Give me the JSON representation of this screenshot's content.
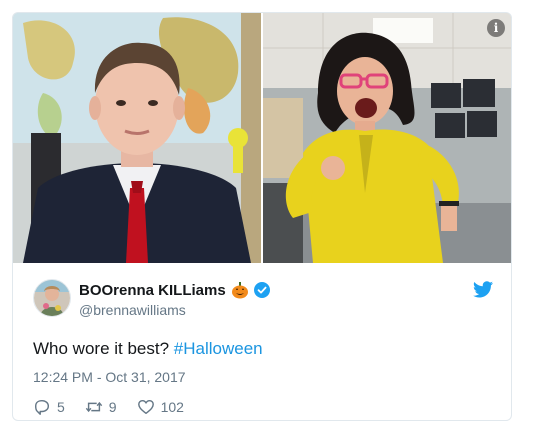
{
  "tweet": {
    "display_name": "BOOrenna KILLiams",
    "handle": "@brennawilliams",
    "text_prefix": "Who wore it best? ",
    "hashtag": "#Halloween",
    "timestamp": "12:24 PM - Oct 31, 2017",
    "replies": "5",
    "retweets": "9",
    "likes": "102",
    "info_glyph": "i"
  },
  "icons": {
    "info": "info-icon",
    "twitter": "twitter-bird-icon",
    "verified": "verified-badge-icon",
    "pumpkin": "jack-o-lantern-icon",
    "reply": "reply-icon",
    "retweet": "retweet-icon",
    "like": "heart-icon"
  },
  "colors": {
    "twitter_blue": "#1da1f2",
    "hashtag": "#1b95e0",
    "muted_text": "#657786",
    "tie_red": "#c0111f",
    "cardigan_yellow": "#e8d21d",
    "glasses_pink": "#e0437a"
  }
}
